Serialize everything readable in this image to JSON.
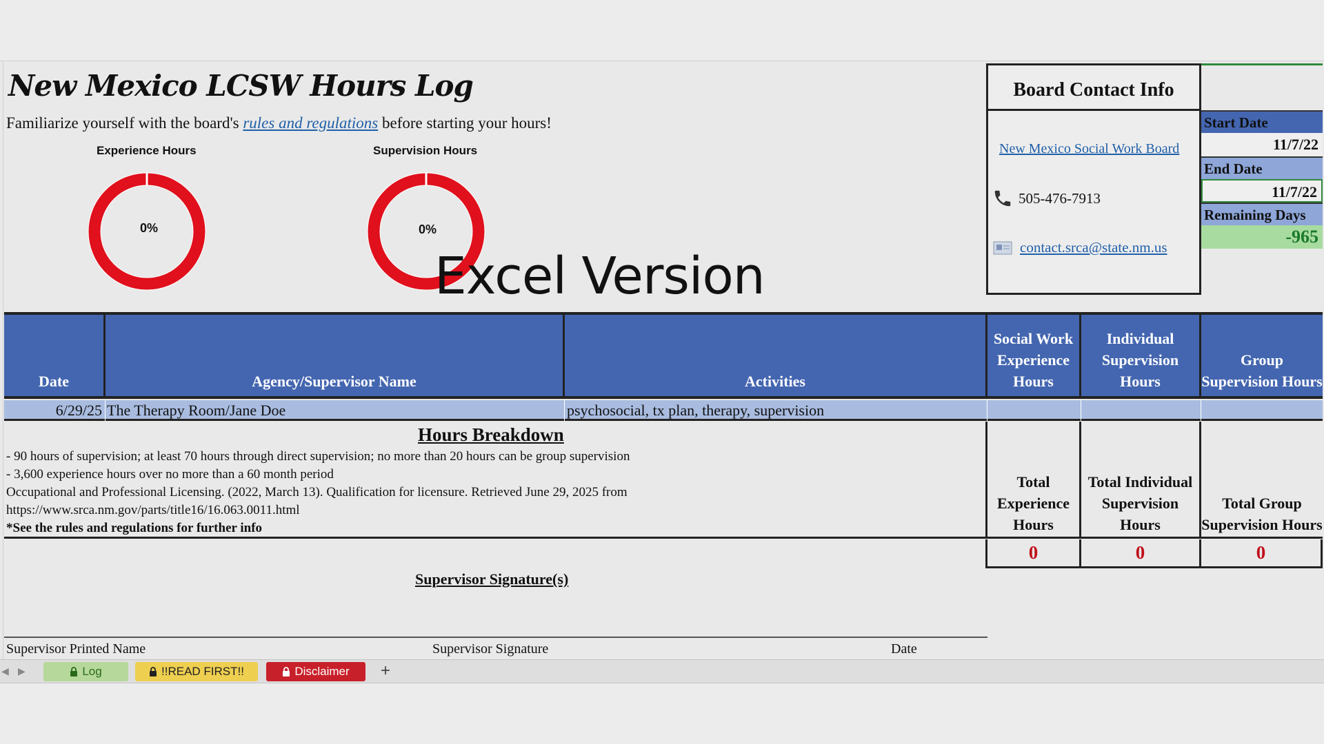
{
  "title": "New Mexico LCSW Hours Log",
  "intro": {
    "before": "Familiarize yourself with the board's ",
    "link": "rules and regulations",
    "after": " before starting your hours!"
  },
  "gauges": [
    {
      "label": "Experience Hours",
      "percent_text": "0%",
      "value": 0,
      "color": "#e0101c"
    },
    {
      "label": "Supervision Hours",
      "percent_text": "0%",
      "value": 0,
      "color": "#e0101c"
    }
  ],
  "overlay": "Excel Version",
  "contact": {
    "header": "Board Contact Info",
    "board_link": "New Mexico Social Work Board",
    "phone": "505-476-7913",
    "email": "contact.srca@state.nm.us"
  },
  "dates": {
    "start_label": "Start Date",
    "start_value": "11/7/22",
    "end_label": "End Date",
    "end_value": "11/7/22",
    "remaining_label": "Remaining Days",
    "remaining_value": "-965"
  },
  "table": {
    "columns": [
      "Date",
      "Agency/Supervisor Name",
      "Activities",
      "Social Work Experience Hours",
      "Individual Supervision Hours",
      "Group Supervision Hours"
    ],
    "rows": [
      {
        "date": "6/29/25",
        "agency": "The Therapy Room/Jane Doe",
        "activities": "psychosocial, tx plan, therapy, supervision",
        "experience": "",
        "individual": "",
        "group": ""
      }
    ]
  },
  "breakdown": {
    "title": "Hours Breakdown",
    "lines": [
      "- 90 hours of supervision; at least 70 hours through direct supervision; no more than 20 hours can be group supervision",
      "- 3,600 experience hours over no more than a 60 month period",
      "Occupational and Professional Licensing. (2022, March 13). Qualification for licensure. Retrieved June 29, 2025 from",
      "https://www.srca.nm.gov/parts/title16/16.063.0011.html",
      "*See the rules and regulations for further info"
    ]
  },
  "totals": {
    "experience_label": "Total Experience Hours",
    "individual_label": "Total Individual Supervision Hours",
    "group_label": "Total Group Supervision Hours",
    "experience_value": "0",
    "individual_value": "0",
    "group_value": "0"
  },
  "signature": {
    "title": "Supervisor Signature(s)",
    "printed_name": "Supervisor Printed Name",
    "signature": "Supervisor Signature",
    "date": "Date"
  },
  "tabs": [
    {
      "label": "Log",
      "icon": "lock-icon"
    },
    {
      "label": "!!READ FIRST!!",
      "icon": "lock-icon"
    },
    {
      "label": "Disclaimer",
      "icon": "lock-icon"
    }
  ],
  "add_tab": "+"
}
